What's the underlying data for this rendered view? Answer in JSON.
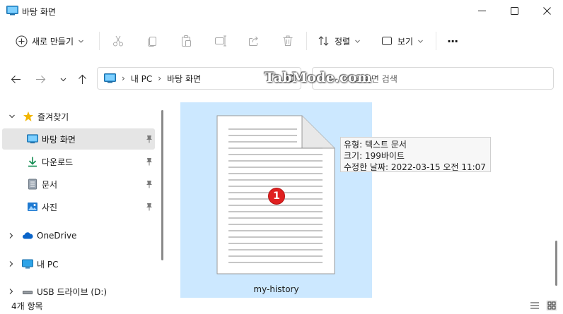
{
  "window": {
    "title": "바탕 화면",
    "controls": [
      "minimize",
      "maximize",
      "close"
    ]
  },
  "toolbar": {
    "new_label": "새로 만들기",
    "actions": [
      "cut-icon",
      "copy-icon",
      "paste-icon",
      "rename-icon",
      "share-icon",
      "delete-icon"
    ],
    "sort_label": "정렬",
    "view_label": "보기",
    "more_label": "···"
  },
  "address": {
    "segments": [
      "내 PC",
      "바탕 화면"
    ],
    "search_placeholder": "바탕 화면 검색"
  },
  "watermark": "TabMode.com",
  "sidebar": {
    "items": [
      {
        "label": "즐겨찾기",
        "icon": "star-icon",
        "expanded": true
      },
      {
        "label": "바탕 화면",
        "icon": "desktop-icon",
        "pinned": true,
        "selected": true
      },
      {
        "label": "다운로드",
        "icon": "download-icon",
        "pinned": true
      },
      {
        "label": "문서",
        "icon": "document-icon",
        "pinned": true
      },
      {
        "label": "사진",
        "icon": "pictures-icon",
        "pinned": true
      },
      {
        "label": "OneDrive",
        "icon": "cloud-icon",
        "expanded": false
      },
      {
        "label": "내 PC",
        "icon": "pc-icon",
        "expanded": false
      },
      {
        "label": "USB 드라이브 (D:)",
        "icon": "usb-drive-icon",
        "expanded": false
      }
    ]
  },
  "files": [
    {
      "name": "my-history",
      "icon": "text-file-icon",
      "selected": true
    }
  ],
  "badge": "1",
  "tooltip": {
    "type": "유형: 텍스트 문서",
    "size": "크기: 199바이트",
    "modified": "수정한 날짜: 2022-03-15 오전 11:07"
  },
  "status": {
    "item_count": "4개 항목"
  },
  "colors": {
    "selection": "#cce8ff",
    "nav_selected": "#e5e5e5",
    "badge": "#e02020",
    "star": "#f2b600",
    "folder_blue": "#0078d4"
  }
}
